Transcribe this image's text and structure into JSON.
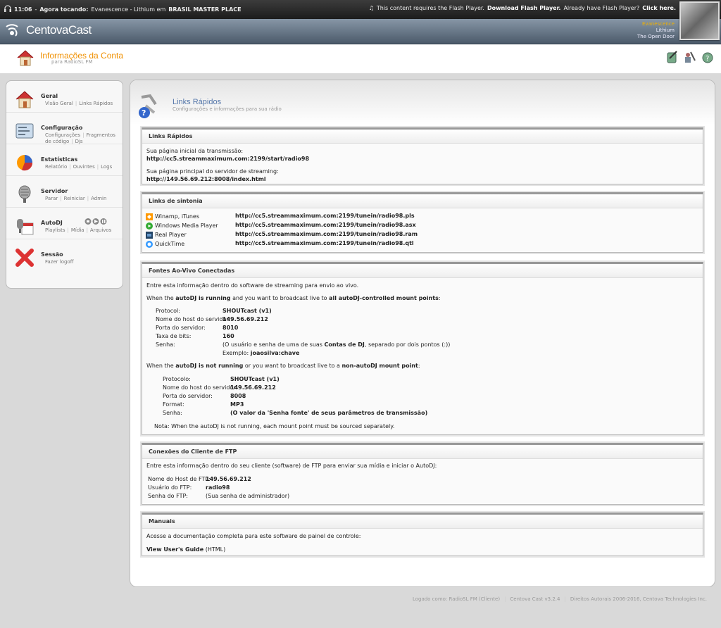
{
  "now_playing": {
    "time": "11:06",
    "label": "Agora tocando:",
    "track": "Evanescence - Lithium em",
    "station": "BRASIL MASTER PLACE"
  },
  "flash": {
    "text": "This content requires the Flash Player.",
    "download": "Download Flash Player.",
    "already": "Already have Flash Player?",
    "click": "Click here."
  },
  "brand": {
    "logo": "CentovaCast"
  },
  "track_info": {
    "artist": "Evanescence",
    "title": "Lithium",
    "album": "The Open Door"
  },
  "account": {
    "title": "Informações da Conta",
    "subtitle": "para RadioSL FM"
  },
  "sidebar": [
    {
      "head": "Geral",
      "links": [
        "Visão Geral",
        "Links Rápidos"
      ]
    },
    {
      "head": "Configuração",
      "links": [
        "Configurações",
        "Fragmentos de código",
        "Djs"
      ]
    },
    {
      "head": "Estatísticas",
      "links": [
        "Relatório",
        "Ouvintes",
        "Logs"
      ]
    },
    {
      "head": "Servidor",
      "links": [
        "Parar",
        "Reiniciar",
        "Admin"
      ]
    },
    {
      "head": "AutoDJ",
      "links": [
        "Playlists",
        "Mídia",
        "Arquivos"
      ]
    },
    {
      "head": "Sessão",
      "links": [
        "Fazer logoff"
      ]
    }
  ],
  "page": {
    "title": "Links Rápidos",
    "subtitle": "Configurações e informações para sua rádio"
  },
  "quick_links": {
    "header": "Links Rápidos",
    "start_label": "Sua página inicial da transmissão:",
    "start_url": "http://cc5.streammaximum.com:2199/start/radio98",
    "server_label": "Sua página principal do servidor de streaming:",
    "server_url": "http://149.56.69.212:8008/index.html"
  },
  "tune_links": {
    "header": "Links de sintonia",
    "rows": [
      {
        "name": "Winamp, iTunes",
        "url": "http://cc5.streammaximum.com:2199/tunein/radio98.pls"
      },
      {
        "name": "Windows Media Player",
        "url": "http://cc5.streammaximum.com:2199/tunein/radio98.asx"
      },
      {
        "name": "Real Player",
        "url": "http://cc5.streammaximum.com:2199/tunein/radio98.ram"
      },
      {
        "name": "QuickTime",
        "url": "http://cc5.streammaximum.com:2199/tunein/radio98.qtl"
      }
    ]
  },
  "live": {
    "header": "Fontes Ao-Vivo Conectadas",
    "intro": "Entre esta informação dentro do software de streaming para envio ao vivo.",
    "a_when": "When the",
    "a_b1": "autoDJ is running",
    "a_mid": "and you want to broadcast live to",
    "a_b2": "all autoDJ-controlled mount points",
    "protocol_l": "Protocol:",
    "protocol_v": "SHOUTcast (v1)",
    "host_l": "Nome do host do servidor:",
    "host_v": "149.56.69.212",
    "port_l": "Porta do servidor:",
    "port_a": "8010",
    "bitrate_l": "Taxa de bits:",
    "bitrate_v": "160",
    "pass_l": "Senha:",
    "pass_note_a": "(O usuário e senha de uma de suas",
    "pass_note_b": "Contas de DJ",
    "pass_note_c": ", separado por dois pontos (:))",
    "example_l": "Exemplo:",
    "example_v": "joaosilva:chave",
    "b_when": "When the",
    "b_b1": "autoDJ is not running",
    "b_mid": "or you want to broadcast live to a",
    "b_b2": "non-autoDJ mount point",
    "protocol2_l": "Protocolo:",
    "port_b": "8008",
    "format_l": "Format:",
    "format_v": "MP3",
    "pass_b": "(O valor da 'Senha fonte' de seus parâmetros de transmissão)",
    "note": "Nota: When the autoDJ is not running, each mount point must be sourced separately."
  },
  "ftp": {
    "header": "Conexões do Cliente de FTP",
    "intro": "Entre esta informação dentro do seu cliente (software) de FTP para enviar sua mídia e iniciar o AutoDJ:",
    "host_l": "Nome do Host de FTP:",
    "host_v": "149.56.69.212",
    "user_l": "Usuário do FTP:",
    "user_v": "radio98",
    "pass_l": "Senha do FTP:",
    "pass_v": "(Sua senha de administrador)"
  },
  "manuals": {
    "header": "Manuais",
    "intro": "Acesse a documentação completa para este software de painel de controle:",
    "link": "View User's Guide",
    "suffix": "(HTML)"
  },
  "footer": {
    "logged": "Logado como: RadioSL FM (Cliente)",
    "version": "Centova Cast v3.2.4",
    "copyright": "Direitos Autorais 2006-2016, Centova Technologies Inc."
  }
}
